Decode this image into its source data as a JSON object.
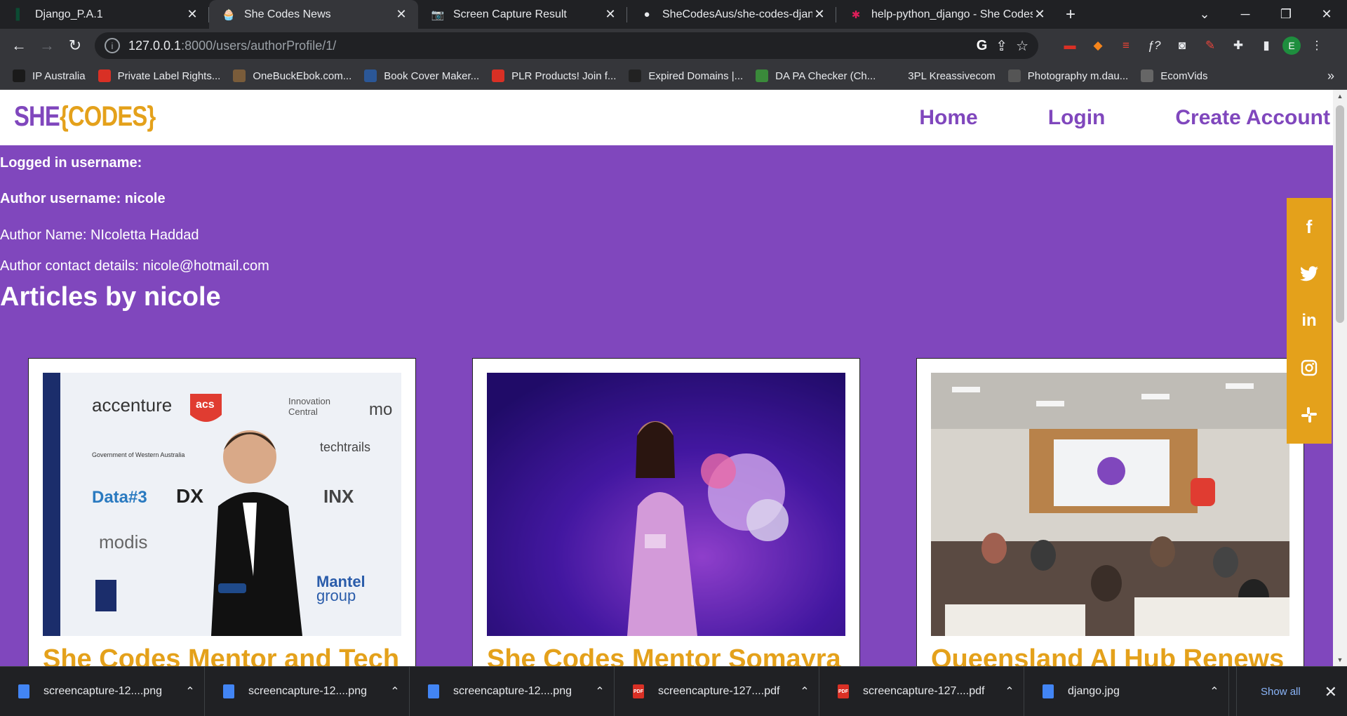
{
  "tabs": [
    {
      "label": "Django_P.A.1",
      "icon": "django-icon"
    },
    {
      "label": "She Codes News",
      "icon": "cupcake-icon"
    },
    {
      "label": "Screen Capture Result",
      "icon": "camera-icon"
    },
    {
      "label": "SheCodesAus/she-codes-django",
      "icon": "github-icon"
    },
    {
      "label": "help-python_django - She Codes",
      "icon": "slack-icon"
    }
  ],
  "url": {
    "host": "127.0.0.1",
    "path": ":8000/users/authorProfile/1/"
  },
  "profile_initial": "E",
  "bookmarks": [
    {
      "label": "IP Australia",
      "color": "#1a1a1a"
    },
    {
      "label": "Private Label Rights...",
      "color": "#d93025"
    },
    {
      "label": "OneBuckEbok.com...",
      "color": "#7a5c3a"
    },
    {
      "label": "Book Cover Maker...",
      "color": "#2b5797"
    },
    {
      "label": "PLR Products! Join f...",
      "color": "#d93025"
    },
    {
      "label": "Expired Domains |...",
      "color": "#222"
    },
    {
      "label": "DA PA Checker (Ch...",
      "color": "#3a8a3a"
    },
    {
      "label": "3PL Kreassivecom",
      "color": "#35363a"
    },
    {
      "label": "Photography m.dau...",
      "color": "#555"
    },
    {
      "label": "EcomVids",
      "color": "#666"
    }
  ],
  "site": {
    "logo_she": "SHE",
    "logo_codes": "{CODES}",
    "nav": {
      "home": "Home",
      "login": "Login",
      "create": "Create Account"
    },
    "logged_in": "Logged in username:",
    "author_username": "Author username: nicole",
    "author_name": "Author Name: NIcoletta Haddad",
    "author_contact": "Author contact details: nicole@hotmail.com",
    "articles_heading": "Articles by nicole",
    "cards": [
      {
        "title": "She Codes Mentor and Tech"
      },
      {
        "title": "She Codes Mentor Somayra"
      },
      {
        "title": "Queensland AI Hub Renews"
      }
    ],
    "social": [
      "facebook-icon",
      "twitter-icon",
      "linkedin-icon",
      "instagram-icon",
      "slack-icon"
    ]
  },
  "downloads": [
    {
      "name": "screencapture-12....png",
      "type": "png"
    },
    {
      "name": "screencapture-12....png",
      "type": "png"
    },
    {
      "name": "screencapture-12....png",
      "type": "png"
    },
    {
      "name": "screencapture-127....pdf",
      "type": "pdf"
    },
    {
      "name": "screencapture-127....pdf",
      "type": "pdf"
    },
    {
      "name": "django.jpg",
      "type": "jpg"
    }
  ],
  "show_all": "Show all",
  "colors": {
    "purple": "#8047bd",
    "gold": "#e4a11b"
  }
}
